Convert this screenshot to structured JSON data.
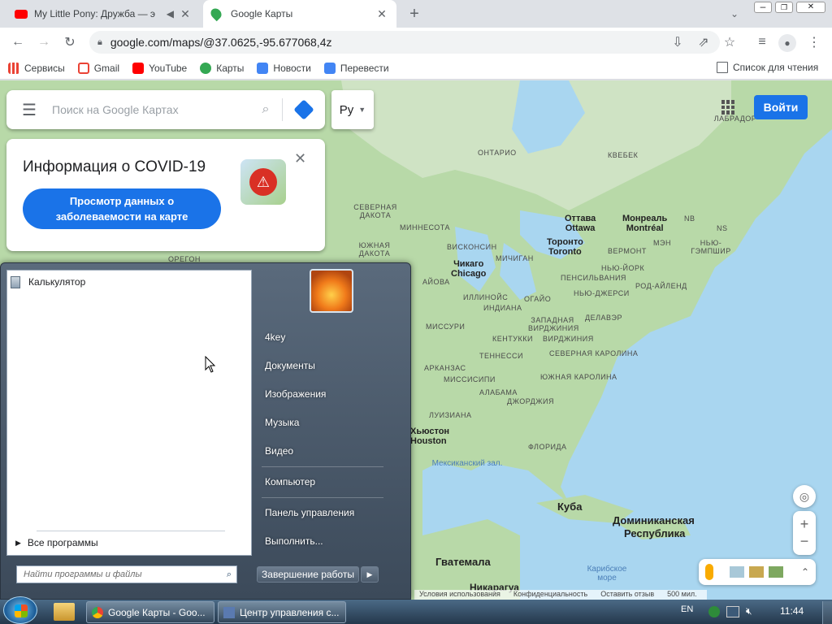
{
  "browser": {
    "tabs": [
      {
        "title": "My Little Pony: Дружба — э",
        "active": false
      },
      {
        "title": "Google Карты",
        "active": true
      }
    ],
    "url": "google.com/maps/@37.0625,-95.677068,4z",
    "bookmarks": [
      "Сервисы",
      "Gmail",
      "YouTube",
      "Карты",
      "Новости",
      "Перевести"
    ],
    "reading_list": "Список для чтения"
  },
  "maps": {
    "search_placeholder": "Поиск на Google Картах",
    "layer_label": "Ру",
    "signin": "Войти",
    "covid": {
      "title": "Информация о COVID-19",
      "button": "Просмотр данных о заболеваемости на карте"
    },
    "footer": [
      "Условия использования",
      "Конфиденциальность",
      "Оставить отзыв",
      "500 мил."
    ],
    "region_labels": [
      "ОНТАРИО",
      "КВЕБЕК",
      "СЕВЕРНАЯ ДАКОТА",
      "МИННЕСОТА",
      "ЮЖНАЯ ДАКОТА",
      "ОРЕГОН",
      "ВИСКОНСИН",
      "МИЧИГАН",
      "АЙОВА",
      "ИЛЛИНОЙС",
      "ИНДИАНА",
      "ОГАЙО",
      "ПЕНСИЛЬВАНИЯ",
      "НЬЮ-ЙОРК",
      "ВЕРМОНТ",
      "МЭН",
      "НЬЮ-ГЭМПШИР",
      "NB",
      "NS",
      "МИССУРИ",
      "КЕНТУККИ",
      "ЗАПАДНАЯ ВИРДЖИНИЯ",
      "ВИРДЖИНИЯ",
      "ДЕЛАВЭР",
      "ТЕННЕССИ",
      "СЕВЕРНАЯ КАРОЛИНА",
      "АРКАНЗАС",
      "ЮЖНАЯ КАРОЛИНА",
      "МИССИСИПИ",
      "АЛАБАМА",
      "ДЖОРДЖИЯ",
      "ЛУИЗИАНА",
      "ФЛОРИДА",
      "РОД-АЙЛЕНД",
      "НЬЮ-ДЖЕРСИ",
      "ЛАБРАДОР"
    ],
    "cities": [
      "Оттава",
      "Ottawa",
      "Монреаль",
      "Montréal",
      "Торонто",
      "Toronto",
      "Чикаго",
      "Chicago",
      "Хьюстон",
      "Houston"
    ],
    "countries": [
      "Куба",
      "Доминиканская",
      "Республика",
      "Гватемала",
      "Никарагуа"
    ],
    "waters": [
      "Мексиканский зал.",
      "Карибское море"
    ]
  },
  "start_menu": {
    "pinned": [
      "Калькулятор"
    ],
    "all_programs": "Все программы",
    "search_placeholder": "Найти программы и файлы",
    "right_items": [
      "4key",
      "Документы",
      "Изображения",
      "Музыка",
      "Видео",
      "Компьютер",
      "Панель управления",
      "Выполнить..."
    ],
    "shutdown": "Завершение работы"
  },
  "taskbar": {
    "tasks": [
      "Google Карты - Goo...",
      "Центр управления с..."
    ],
    "lang": "EN",
    "time": "11:44"
  }
}
